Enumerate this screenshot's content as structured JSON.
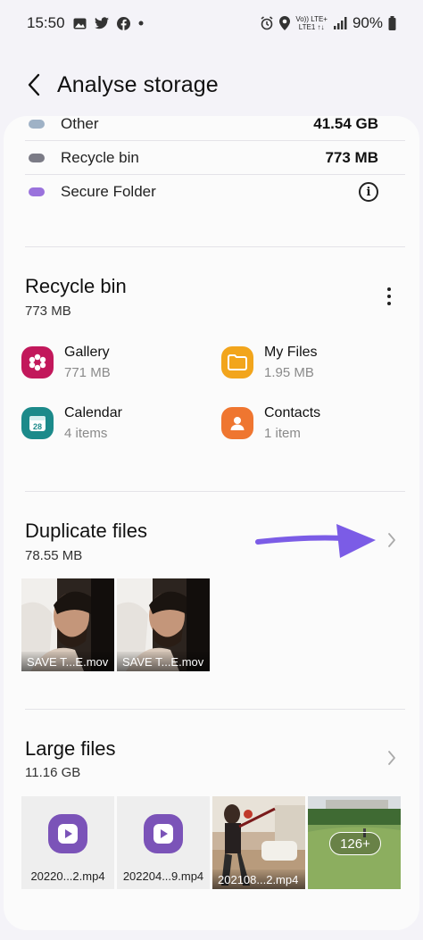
{
  "status_bar": {
    "time": "15:50",
    "net_top": "Vo))  LTE+",
    "net_bottom": "LTE1 ↑↓",
    "battery": "90%"
  },
  "header": {
    "title": "Analyse storage"
  },
  "legend": [
    {
      "label": "Other",
      "value": "41.54 GB",
      "color": "#9fb2c6"
    },
    {
      "label": "Recycle bin",
      "value": "773 MB",
      "color": "#7b7b86"
    },
    {
      "label": "Secure Folder",
      "value": "",
      "color": "#9a72dc"
    }
  ],
  "recycle_bin": {
    "title": "Recycle bin",
    "size": "773 MB",
    "apps": [
      {
        "name": "Gallery",
        "size": "771 MB",
        "color": "#c2185b"
      },
      {
        "name": "My Files",
        "size": "1.95 MB",
        "color": "#f2a51c"
      },
      {
        "name": "Calendar",
        "size": "4 items",
        "color": "#1c8a8a"
      },
      {
        "name": "Contacts",
        "size": "1 item",
        "color": "#ef7630"
      }
    ]
  },
  "duplicate_files": {
    "title": "Duplicate files",
    "size": "78.55 MB",
    "thumbs": [
      {
        "caption": "SAVE T...E.mov"
      },
      {
        "caption": "SAVE T...E.mov"
      }
    ]
  },
  "large_files": {
    "title": "Large files",
    "size": "11.16 GB",
    "thumbs": [
      {
        "caption": "20220...2.mp4"
      },
      {
        "caption": "202204...9.mp4"
      },
      {
        "caption": "202108...2.mp4"
      },
      {
        "badge": "126+"
      }
    ]
  },
  "colors": {
    "accent_arrow": "#7b5ce6"
  }
}
